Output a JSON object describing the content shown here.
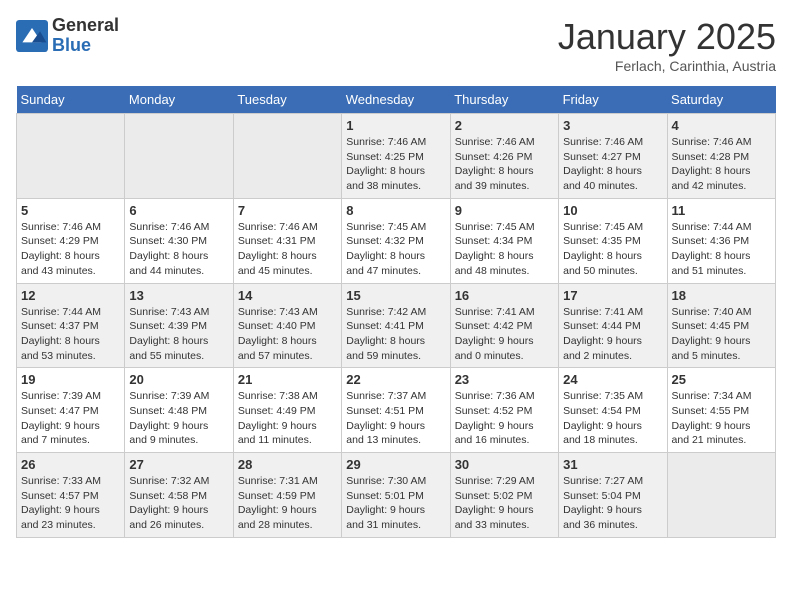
{
  "logo": {
    "general": "General",
    "blue": "Blue"
  },
  "title": "January 2025",
  "subtitle": "Ferlach, Carinthia, Austria",
  "days_header": [
    "Sunday",
    "Monday",
    "Tuesday",
    "Wednesday",
    "Thursday",
    "Friday",
    "Saturday"
  ],
  "weeks": [
    [
      {
        "day": "",
        "info": ""
      },
      {
        "day": "",
        "info": ""
      },
      {
        "day": "",
        "info": ""
      },
      {
        "day": "1",
        "info": "Sunrise: 7:46 AM\nSunset: 4:25 PM\nDaylight: 8 hours\nand 38 minutes."
      },
      {
        "day": "2",
        "info": "Sunrise: 7:46 AM\nSunset: 4:26 PM\nDaylight: 8 hours\nand 39 minutes."
      },
      {
        "day": "3",
        "info": "Sunrise: 7:46 AM\nSunset: 4:27 PM\nDaylight: 8 hours\nand 40 minutes."
      },
      {
        "day": "4",
        "info": "Sunrise: 7:46 AM\nSunset: 4:28 PM\nDaylight: 8 hours\nand 42 minutes."
      }
    ],
    [
      {
        "day": "5",
        "info": "Sunrise: 7:46 AM\nSunset: 4:29 PM\nDaylight: 8 hours\nand 43 minutes."
      },
      {
        "day": "6",
        "info": "Sunrise: 7:46 AM\nSunset: 4:30 PM\nDaylight: 8 hours\nand 44 minutes."
      },
      {
        "day": "7",
        "info": "Sunrise: 7:46 AM\nSunset: 4:31 PM\nDaylight: 8 hours\nand 45 minutes."
      },
      {
        "day": "8",
        "info": "Sunrise: 7:45 AM\nSunset: 4:32 PM\nDaylight: 8 hours\nand 47 minutes."
      },
      {
        "day": "9",
        "info": "Sunrise: 7:45 AM\nSunset: 4:34 PM\nDaylight: 8 hours\nand 48 minutes."
      },
      {
        "day": "10",
        "info": "Sunrise: 7:45 AM\nSunset: 4:35 PM\nDaylight: 8 hours\nand 50 minutes."
      },
      {
        "day": "11",
        "info": "Sunrise: 7:44 AM\nSunset: 4:36 PM\nDaylight: 8 hours\nand 51 minutes."
      }
    ],
    [
      {
        "day": "12",
        "info": "Sunrise: 7:44 AM\nSunset: 4:37 PM\nDaylight: 8 hours\nand 53 minutes."
      },
      {
        "day": "13",
        "info": "Sunrise: 7:43 AM\nSunset: 4:39 PM\nDaylight: 8 hours\nand 55 minutes."
      },
      {
        "day": "14",
        "info": "Sunrise: 7:43 AM\nSunset: 4:40 PM\nDaylight: 8 hours\nand 57 minutes."
      },
      {
        "day": "15",
        "info": "Sunrise: 7:42 AM\nSunset: 4:41 PM\nDaylight: 8 hours\nand 59 minutes."
      },
      {
        "day": "16",
        "info": "Sunrise: 7:41 AM\nSunset: 4:42 PM\nDaylight: 9 hours\nand 0 minutes."
      },
      {
        "day": "17",
        "info": "Sunrise: 7:41 AM\nSunset: 4:44 PM\nDaylight: 9 hours\nand 2 minutes."
      },
      {
        "day": "18",
        "info": "Sunrise: 7:40 AM\nSunset: 4:45 PM\nDaylight: 9 hours\nand 5 minutes."
      }
    ],
    [
      {
        "day": "19",
        "info": "Sunrise: 7:39 AM\nSunset: 4:47 PM\nDaylight: 9 hours\nand 7 minutes."
      },
      {
        "day": "20",
        "info": "Sunrise: 7:39 AM\nSunset: 4:48 PM\nDaylight: 9 hours\nand 9 minutes."
      },
      {
        "day": "21",
        "info": "Sunrise: 7:38 AM\nSunset: 4:49 PM\nDaylight: 9 hours\nand 11 minutes."
      },
      {
        "day": "22",
        "info": "Sunrise: 7:37 AM\nSunset: 4:51 PM\nDaylight: 9 hours\nand 13 minutes."
      },
      {
        "day": "23",
        "info": "Sunrise: 7:36 AM\nSunset: 4:52 PM\nDaylight: 9 hours\nand 16 minutes."
      },
      {
        "day": "24",
        "info": "Sunrise: 7:35 AM\nSunset: 4:54 PM\nDaylight: 9 hours\nand 18 minutes."
      },
      {
        "day": "25",
        "info": "Sunrise: 7:34 AM\nSunset: 4:55 PM\nDaylight: 9 hours\nand 21 minutes."
      }
    ],
    [
      {
        "day": "26",
        "info": "Sunrise: 7:33 AM\nSunset: 4:57 PM\nDaylight: 9 hours\nand 23 minutes."
      },
      {
        "day": "27",
        "info": "Sunrise: 7:32 AM\nSunset: 4:58 PM\nDaylight: 9 hours\nand 26 minutes."
      },
      {
        "day": "28",
        "info": "Sunrise: 7:31 AM\nSunset: 4:59 PM\nDaylight: 9 hours\nand 28 minutes."
      },
      {
        "day": "29",
        "info": "Sunrise: 7:30 AM\nSunset: 5:01 PM\nDaylight: 9 hours\nand 31 minutes."
      },
      {
        "day": "30",
        "info": "Sunrise: 7:29 AM\nSunset: 5:02 PM\nDaylight: 9 hours\nand 33 minutes."
      },
      {
        "day": "31",
        "info": "Sunrise: 7:27 AM\nSunset: 5:04 PM\nDaylight: 9 hours\nand 36 minutes."
      },
      {
        "day": "",
        "info": ""
      }
    ]
  ]
}
